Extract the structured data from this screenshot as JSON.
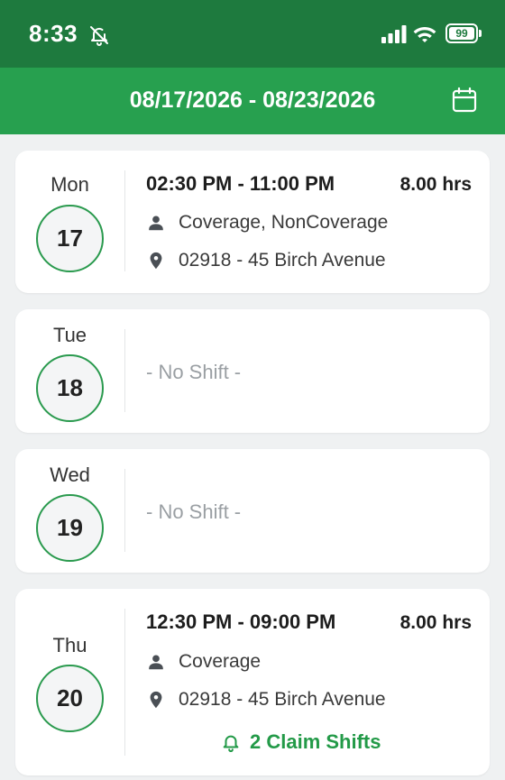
{
  "status_bar": {
    "time": "8:33",
    "battery": "99"
  },
  "header": {
    "date_range": "08/17/2026 - 08/23/2026",
    "calendar_icon": "calendar-icon"
  },
  "days": [
    {
      "day_name": "Mon",
      "day_number": "17",
      "shift_time": "02:30 PM - 11:00 PM",
      "hours": "8.00 hrs",
      "role": "Coverage, NonCoverage",
      "location": "02918 - 45 Birch Avenue"
    },
    {
      "day_name": "Tue",
      "day_number": "18",
      "no_shift": "- No Shift -"
    },
    {
      "day_name": "Wed",
      "day_number": "19",
      "no_shift": "- No Shift -"
    },
    {
      "day_name": "Thu",
      "day_number": "20",
      "shift_time": "12:30 PM - 09:00 PM",
      "hours": "8.00 hrs",
      "role": "Coverage",
      "location": "02918 - 45 Birch Avenue",
      "claim_label": "2 Claim Shifts"
    }
  ],
  "colors": {
    "status_bar": "#1e7a3e",
    "header": "#27a04f",
    "accent": "#239a48"
  }
}
